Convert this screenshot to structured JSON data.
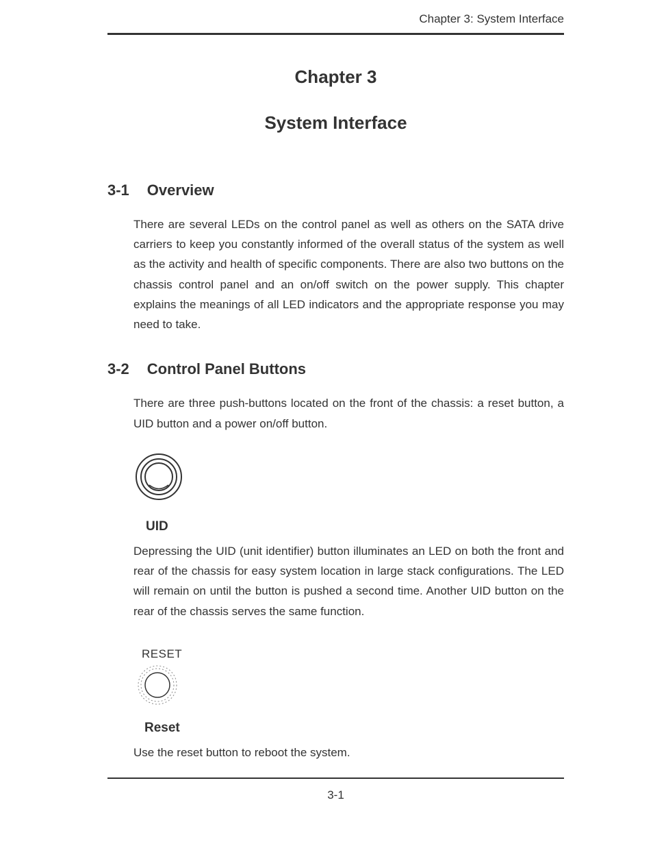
{
  "header": {
    "running": "Chapter 3: System Interface"
  },
  "chapter": {
    "number": "Chapter 3",
    "title": "System Interface"
  },
  "sections": {
    "overview": {
      "num": "3-1",
      "title": "Overview",
      "body": "There are several LEDs on the control panel as well as others on the SATA drive carriers to keep you constantly informed of the overall status of the system as well as the activity and health of specific components. There are also two buttons on the chassis control panel and an on/off switch on the power supply. This chapter explains the meanings of all LED indicators and the appropriate response you may need to take."
    },
    "buttons": {
      "num": "3-2",
      "title": "Control Panel Buttons",
      "intro": "There are three push-buttons located on the front of the chassis: a reset button, a UID button and a power on/off button.",
      "uid": {
        "label": "UID",
        "body": "Depressing the UID (unit identifier) button illuminates an LED on both the front and rear of the chassis for easy system location in large stack configurations. The LED will remain on until the button is pushed a second time. Another UID button on the rear of the chassis serves the same function."
      },
      "reset": {
        "top_label": "RESET",
        "label": "Reset",
        "body": "Use the reset button to reboot the system."
      }
    }
  },
  "footer": {
    "page": "3-1"
  }
}
